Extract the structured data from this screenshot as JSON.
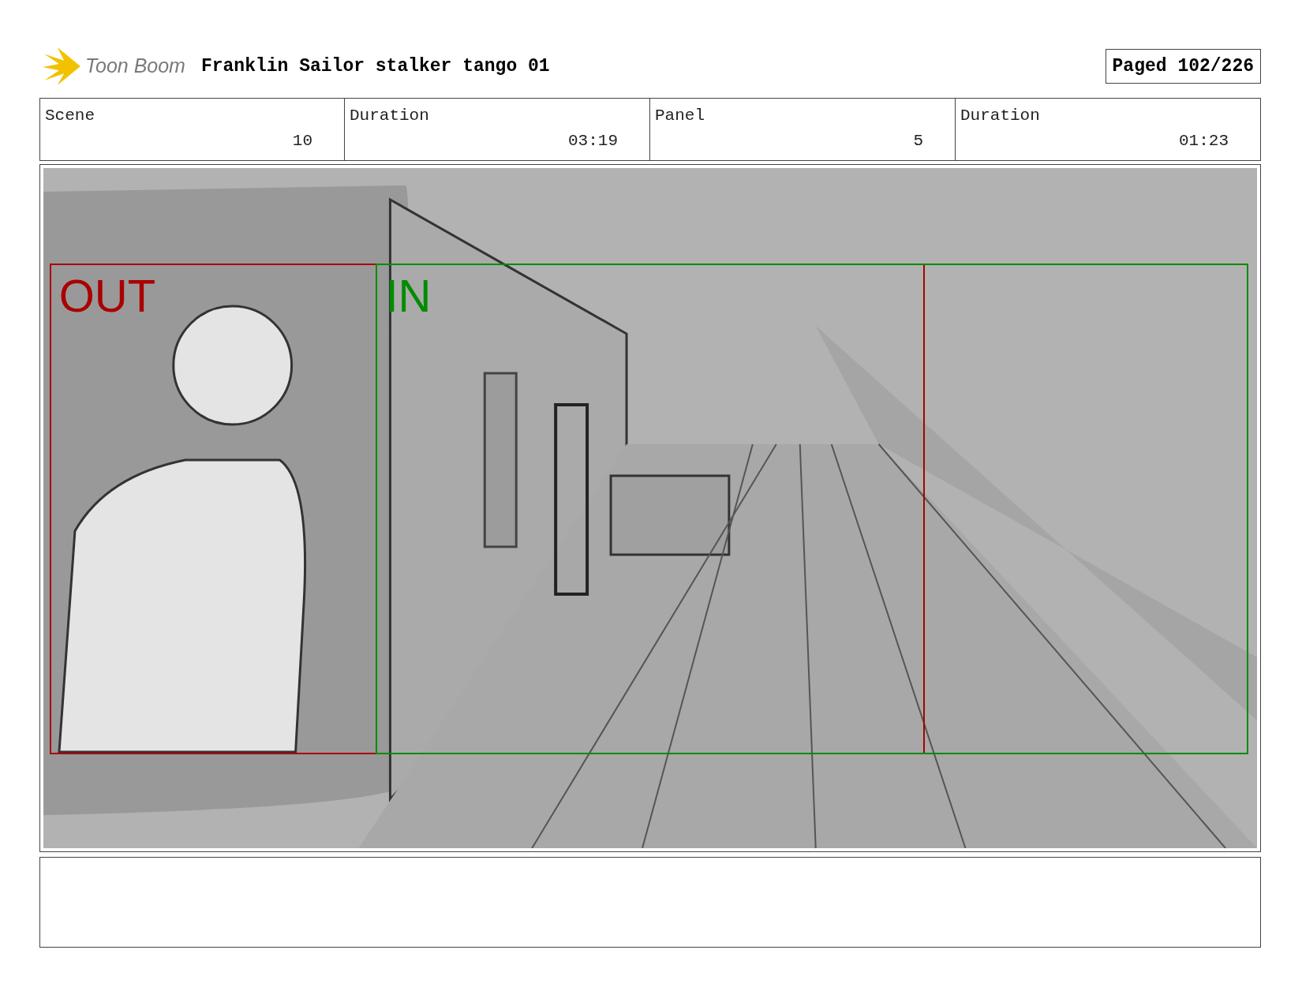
{
  "header": {
    "logo_text": "Toon Boom",
    "title": "Franklin Sailor stalker tango 01",
    "page": "Paged 102/226"
  },
  "fields": [
    {
      "label": "Scene",
      "value": "10"
    },
    {
      "label": "Duration",
      "value": "03:19"
    },
    {
      "label": "Panel",
      "value": "5"
    },
    {
      "label": "Duration",
      "value": "01:23"
    }
  ],
  "panel": {
    "frames": [
      {
        "label": "OUT",
        "color": "#aa0000"
      },
      {
        "label": "IN",
        "color": "#008c00"
      }
    ]
  }
}
